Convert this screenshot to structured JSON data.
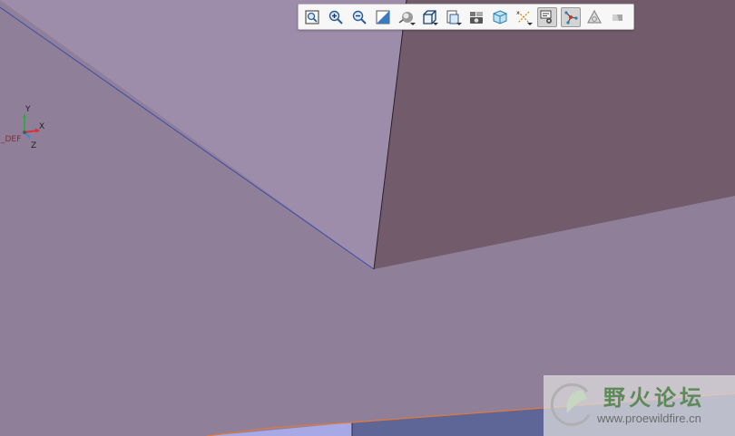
{
  "viewport": {
    "background_color": "#8f7f99",
    "upper_face_color": "#9e8cab",
    "right_face_color": "#725c6b",
    "bottom_face_color": "#5e6597",
    "bottom_face_light_color": "#a7a9e6",
    "edge_blue_color": "#3b4fa8",
    "edge_orange_color": "#e07a3c"
  },
  "toolbar": {
    "buttons": [
      {
        "name": "refit",
        "icon": "refit-icon",
        "active": false,
        "has_dropdown": false
      },
      {
        "name": "zoom-in",
        "icon": "zoom-in-icon",
        "active": false,
        "has_dropdown": false
      },
      {
        "name": "zoom-out",
        "icon": "zoom-out-icon",
        "active": false,
        "has_dropdown": false
      },
      {
        "name": "repaint",
        "icon": "repaint-icon",
        "active": false,
        "has_dropdown": false
      },
      {
        "name": "display-style",
        "icon": "shading-icon",
        "active": false,
        "has_dropdown": true
      },
      {
        "name": "saved-orientations",
        "icon": "saved-views-icon",
        "active": false,
        "has_dropdown": true
      },
      {
        "name": "view-manager",
        "icon": "view-manager-icon",
        "active": false,
        "has_dropdown": true
      },
      {
        "name": "perspective-view",
        "icon": "camera-icon",
        "active": false,
        "has_dropdown": false
      },
      {
        "name": "section-view",
        "icon": "section-cube-icon",
        "active": false,
        "has_dropdown": false
      },
      {
        "name": "datum-display",
        "icon": "datum-display-icon",
        "active": false,
        "has_dropdown": true
      },
      {
        "name": "annotation-display",
        "icon": "annotation-display-icon",
        "active": true,
        "has_dropdown": false
      },
      {
        "name": "spin-center",
        "icon": "spin-center-icon",
        "active": true,
        "has_dropdown": false
      },
      {
        "name": "simulation-display",
        "icon": "simulation-triangle-icon",
        "active": false,
        "has_dropdown": false
      },
      {
        "name": "appearance",
        "icon": "appearance-icon",
        "active": false,
        "has_dropdown": false
      }
    ]
  },
  "triad": {
    "y_label": "Y",
    "x_label": "X",
    "z_label": "Z",
    "csys_label": "_DEF",
    "x_color": "#d8303a",
    "y_color": "#3aa34a",
    "z_color": "#3a8ad0"
  },
  "watermark": {
    "title": "野火论坛",
    "url": "www.proewildfire.cn"
  }
}
